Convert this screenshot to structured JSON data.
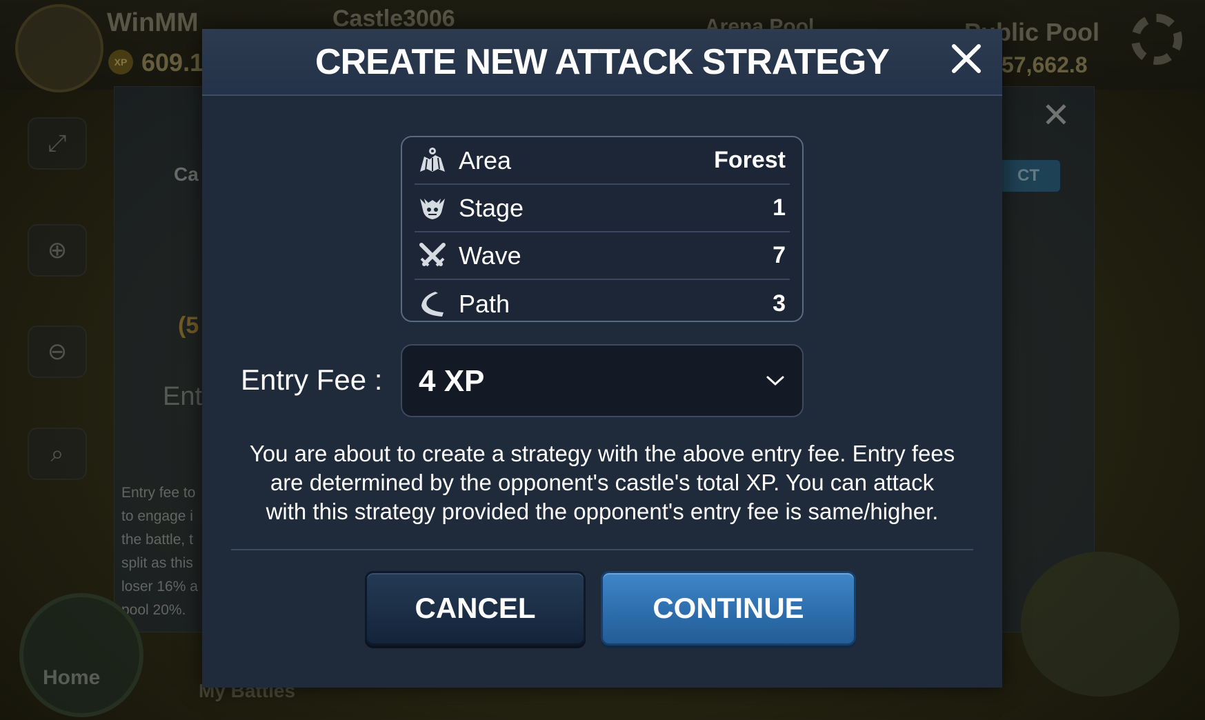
{
  "background": {
    "player_name": "WinMM",
    "player_xp_badge": "XP",
    "player_xp": "609.1",
    "castle_name": "Castle3006",
    "arena_pool_label": "Arena Pool",
    "public_pool_label": "Public Pool",
    "public_pool_value": "57,662.8",
    "panel_heading": "Ca",
    "panel_number": "(5",
    "panel_entry": "Ent",
    "select_button": "CT",
    "panel_text_lines": [
      "Entry fee to",
      "to engage i",
      "the battle, t",
      "split as this",
      "loser 16% a",
      "pool 20%."
    ],
    "home_label": "Home",
    "my_battles_label": "My Battles"
  },
  "modal": {
    "title": "CREATE NEW ATTACK STRATEGY",
    "details": [
      {
        "icon": "map-icon",
        "label": "Area",
        "value": "Forest"
      },
      {
        "icon": "monster-icon",
        "label": "Stage",
        "value": "1"
      },
      {
        "icon": "crossed-swords-icon",
        "label": "Wave",
        "value": "7"
      },
      {
        "icon": "path-icon",
        "label": "Path",
        "value": "3"
      }
    ],
    "entry_fee_label": "Entry Fee :",
    "entry_fee_value": "4 XP",
    "notice_lines": [
      "You are about to create a strategy with the above entry fee. Entry fees",
      "are determined by the opponent's castle's total XP. You can attack",
      "with this strategy provided the opponent's entry fee is same/higher."
    ],
    "cancel_label": "CANCEL",
    "continue_label": "CONTINUE"
  },
  "colors": {
    "modal_bg": "#1f2a3b",
    "continue_button": "#2c6cab",
    "cancel_button": "#1a2d44"
  }
}
